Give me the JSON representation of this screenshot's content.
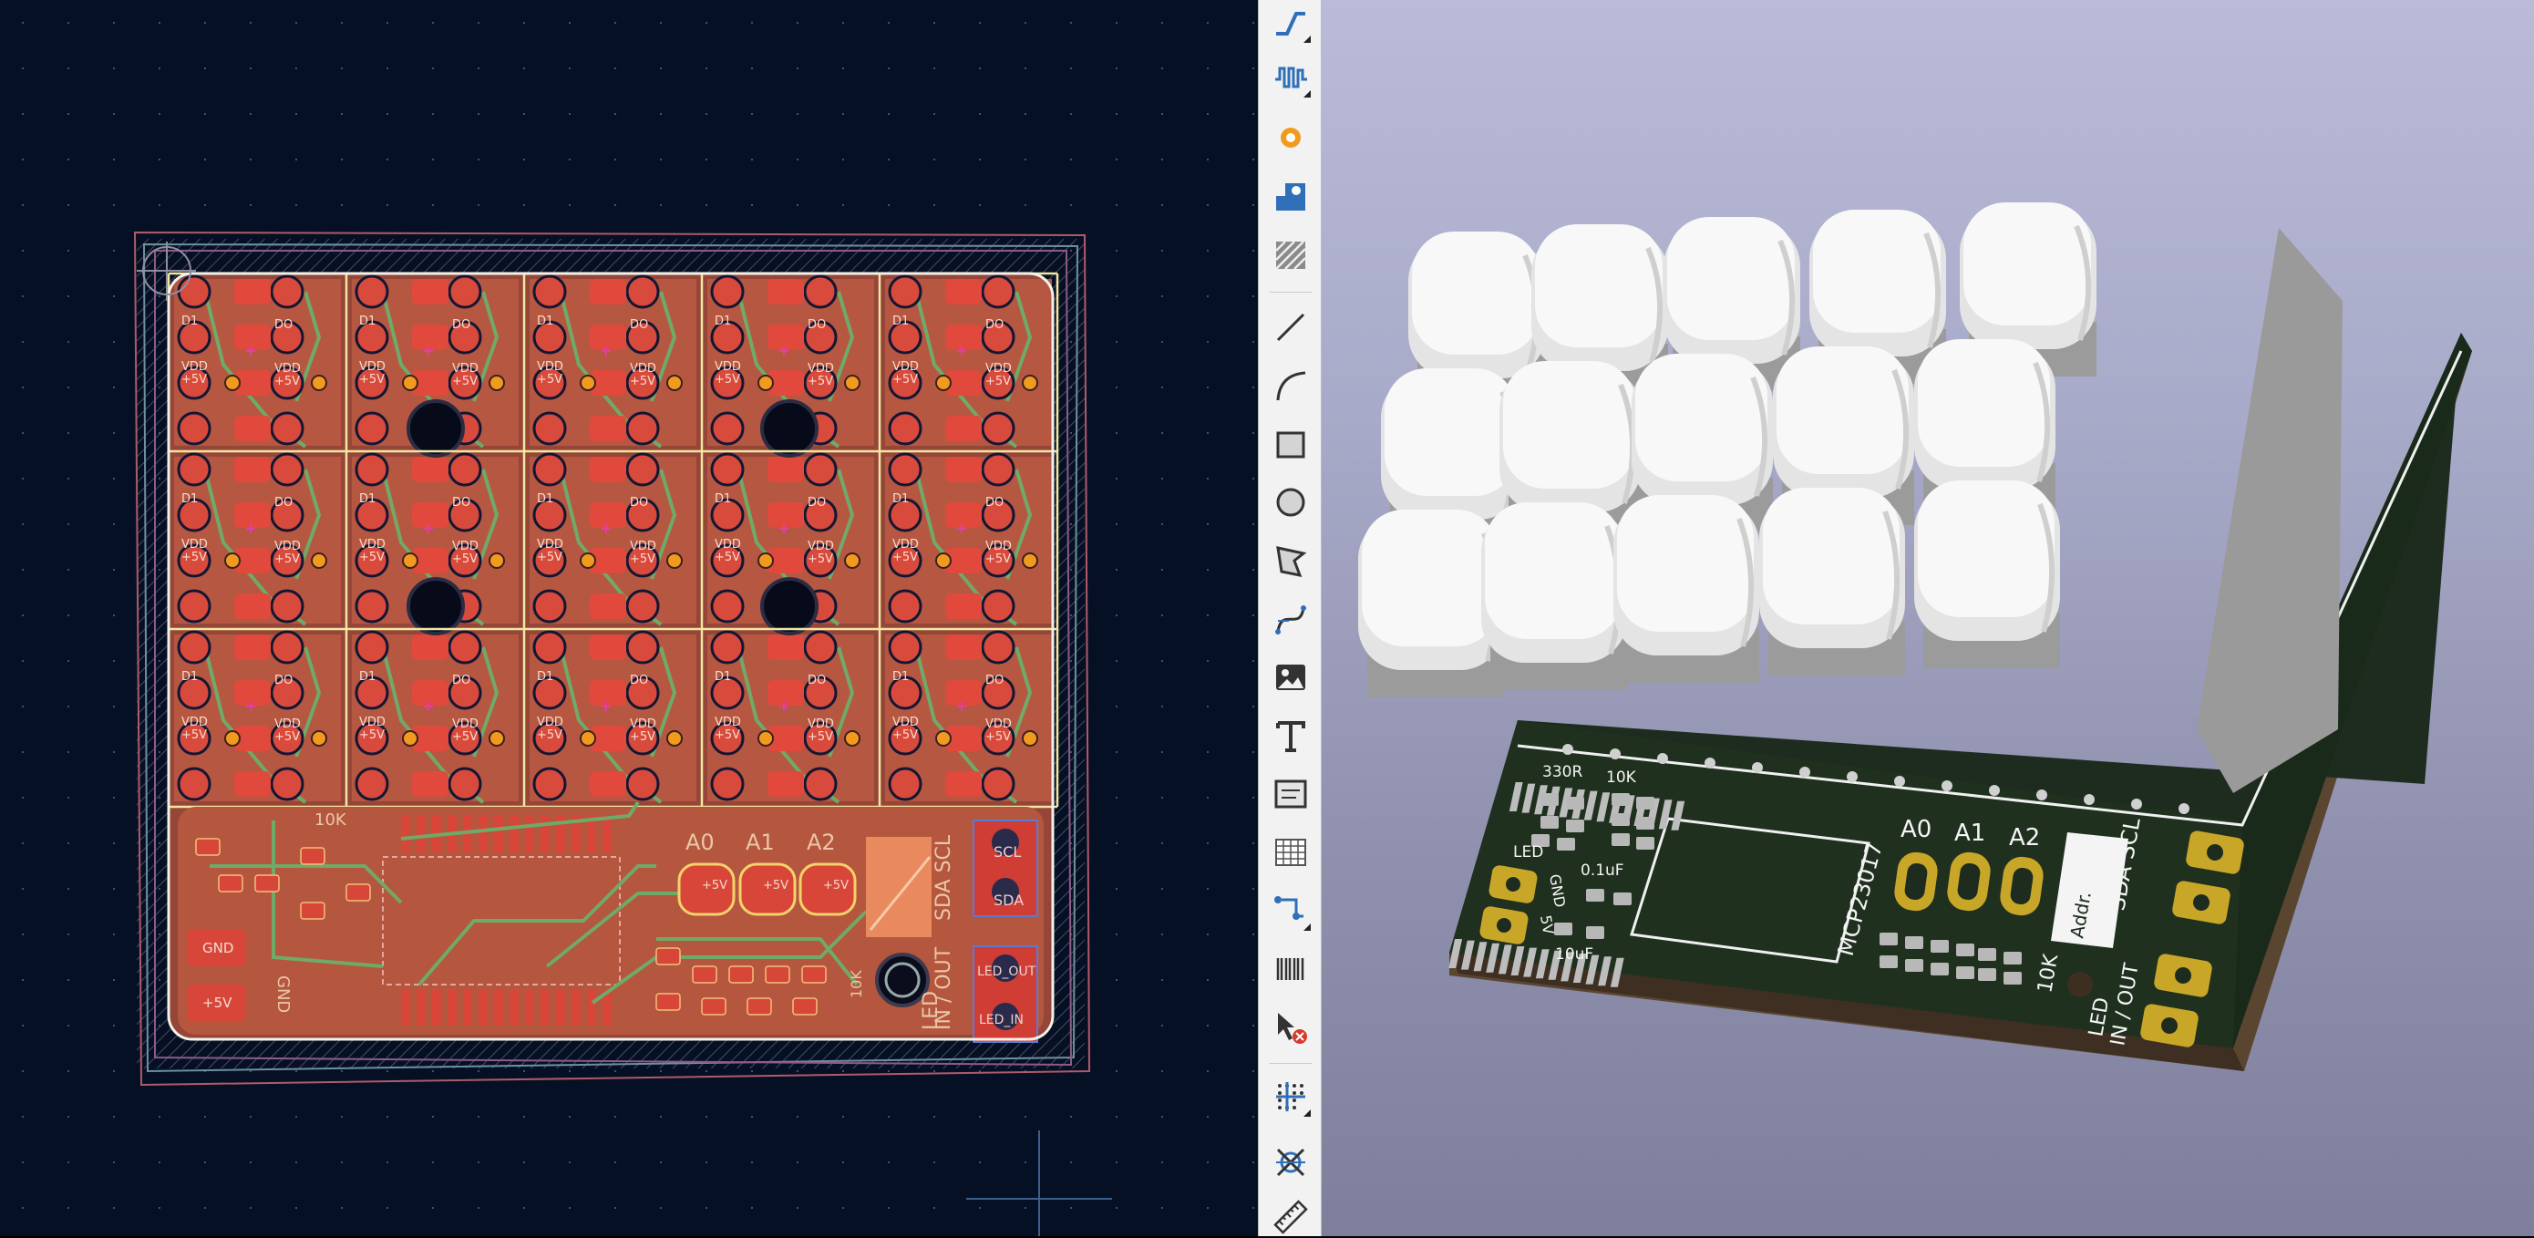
{
  "pcb_editor": {
    "cell_labels": {
      "d1": "D1",
      "di": "DI",
      "do": "DO",
      "vdd": "VDD",
      "plus5v": "+5V",
      "plus5v_alt": "+5V",
      "gnd": "GND"
    },
    "silk": {
      "a0": "A0",
      "a1": "A1",
      "a2": "A2",
      "scl": "SCL",
      "sda": "SDA",
      "in_out": "IN / OUT",
      "led": "LED",
      "led_out": "LED_OUT",
      "led_in": "LED_IN",
      "plus5v": "+5V",
      "gnd": "GND",
      "res_10k": "10K",
      "res_10k_b": "10K"
    }
  },
  "toolbar": {
    "tools": [
      {
        "name": "route-track-icon",
        "tooltip": "Route tracks"
      },
      {
        "name": "tune-length-icon",
        "tooltip": "Tune track length"
      },
      {
        "name": "add-via-icon",
        "tooltip": "Add vias"
      },
      {
        "name": "add-footprint-icon",
        "tooltip": "Add footprints"
      },
      {
        "name": "add-zone-icon",
        "tooltip": "Add filled zone"
      },
      {
        "name": "draw-line-icon",
        "tooltip": "Draw lines"
      },
      {
        "name": "draw-arc-icon",
        "tooltip": "Draw arcs"
      },
      {
        "name": "draw-rectangle-icon",
        "tooltip": "Draw rectangles"
      },
      {
        "name": "draw-circle-icon",
        "tooltip": "Draw circles"
      },
      {
        "name": "draw-polygon-icon",
        "tooltip": "Draw polygons"
      },
      {
        "name": "draw-bezier-icon",
        "tooltip": "Draw bezier curves"
      },
      {
        "name": "add-image-icon",
        "tooltip": "Add reference image"
      },
      {
        "name": "add-text-icon",
        "tooltip": "Add text"
      },
      {
        "name": "add-textbox-icon",
        "tooltip": "Add text box"
      },
      {
        "name": "add-table-icon",
        "tooltip": "Add table"
      },
      {
        "name": "add-dimension-icon",
        "tooltip": "Add dimension"
      },
      {
        "name": "add-barcode-icon",
        "tooltip": "Add barcode"
      },
      {
        "name": "delete-tool-icon",
        "tooltip": "Delete items"
      },
      {
        "name": "grid-origin-icon",
        "tooltip": "Grid origin"
      },
      {
        "name": "no-connect-icon",
        "tooltip": "Place no-connect"
      },
      {
        "name": "measure-icon",
        "tooltip": "Measure tool"
      }
    ],
    "colors": {
      "accent": "#2f6fb8",
      "orange": "#f29a1d",
      "red": "#d83a2c"
    }
  },
  "viewer_3d": {
    "silkscreen": {
      "led": "LED",
      "r330": "330R",
      "r10k_top": "10K",
      "cap_01uf": "0.1uF",
      "cap_10uf": "10uF",
      "gnd": "GND",
      "v5": "5V",
      "chip": "MCP23017",
      "a0": "A0",
      "a1": "A1",
      "a2": "A2",
      "addr": "Addr.",
      "sda_scl": "SDA SCL",
      "r10k_bottom": "10K",
      "led_in_out_1": "LED",
      "led_in_out_2": "IN / OUT"
    },
    "colors": {
      "board": "#1b2a1b",
      "silkscreen": "#f4f4f4",
      "pad": "#c8a628",
      "diffuser": "#f6f6f6"
    }
  }
}
